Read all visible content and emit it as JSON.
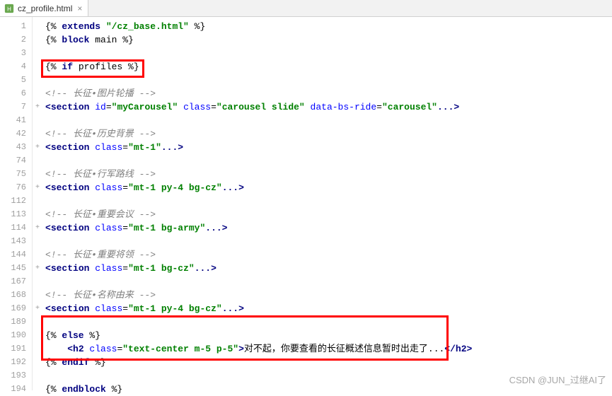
{
  "tab": {
    "filename": "cz_profile.html",
    "close_label": "×"
  },
  "line_numbers": [
    "1",
    "2",
    "3",
    "4",
    "5",
    "6",
    "7",
    "41",
    "42",
    "43",
    "74",
    "75",
    "76",
    "112",
    "113",
    "114",
    "143",
    "144",
    "145",
    "167",
    "168",
    "169",
    "189",
    "190",
    "191",
    "192",
    "193",
    "194"
  ],
  "fold_marks": [
    "",
    "",
    "",
    "",
    "",
    "",
    "+",
    "",
    "",
    "+",
    "",
    "",
    "+",
    "",
    "",
    "+",
    "",
    "",
    "+",
    "",
    "",
    "+",
    "",
    "",
    "",
    "",
    "",
    ""
  ],
  "code": {
    "l1_a": "{% ",
    "l1_b": "extends ",
    "l1_c": "\"/cz_base.html\"",
    "l1_d": " %}",
    "l2_a": "{% ",
    "l2_b": "block ",
    "l2_c": "main %}",
    "l4_a": "{% ",
    "l4_b": "if ",
    "l4_c": "profiles %}",
    "l6": "<!-- 长征•图片轮播 -->",
    "l7_a": "<",
    "l7_b": "section ",
    "l7_c": "id",
    "l7_d": "=",
    "l7_e": "\"myCarousel\"",
    "l7_f": " class",
    "l7_g": "=",
    "l7_h": "\"carousel slide\"",
    "l7_i": " data-bs-ride",
    "l7_j": "=",
    "l7_k": "\"carousel\"",
    "l7_l": "...>",
    "l42": "<!-- 长征•历史背景 -->",
    "l43_a": "<",
    "l43_b": "section ",
    "l43_c": "class",
    "l43_d": "=",
    "l43_e": "\"mt-1\"",
    "l43_f": "...>",
    "l75": "<!-- 长征•行军路线 -->",
    "l76_a": "<",
    "l76_b": "section ",
    "l76_c": "class",
    "l76_d": "=",
    "l76_e": "\"mt-1 py-4 bg-cz\"",
    "l76_f": "...>",
    "l113": "<!-- 长征•重要会议 -->",
    "l114_a": "<",
    "l114_b": "section ",
    "l114_c": "class",
    "l114_d": "=",
    "l114_e": "\"mt-1 bg-army\"",
    "l114_f": "...>",
    "l144": "<!-- 长征•重要将领 -->",
    "l145_a": "<",
    "l145_b": "section ",
    "l145_c": "class",
    "l145_d": "=",
    "l145_e": "\"mt-1 bg-cz\"",
    "l145_f": "...>",
    "l168": "<!-- 长征•名称由来 -->",
    "l169_a": "<",
    "l169_b": "section ",
    "l169_c": "class",
    "l169_d": "=",
    "l169_e": "\"mt-1 py-4 bg-cz\"",
    "l169_f": "...>",
    "l190_a": "{% ",
    "l190_b": "else ",
    "l190_c": "%}",
    "l191_a": "    <",
    "l191_b": "h2 ",
    "l191_c": "class",
    "l191_d": "=",
    "l191_e": "\"text-center m-5 p-5\"",
    "l191_f": ">",
    "l191_g": "对不起，你要查看的长征概述信息暂时出走了...",
    "l191_h": "</",
    "l191_i": "h2",
    "l191_j": ">",
    "l192_a": "{% ",
    "l192_b": "endif ",
    "l192_c": "%}",
    "l194_a": "{% ",
    "l194_b": "endblock ",
    "l194_c": "%}"
  },
  "watermark": "CSDN @JUN_过继AI了"
}
